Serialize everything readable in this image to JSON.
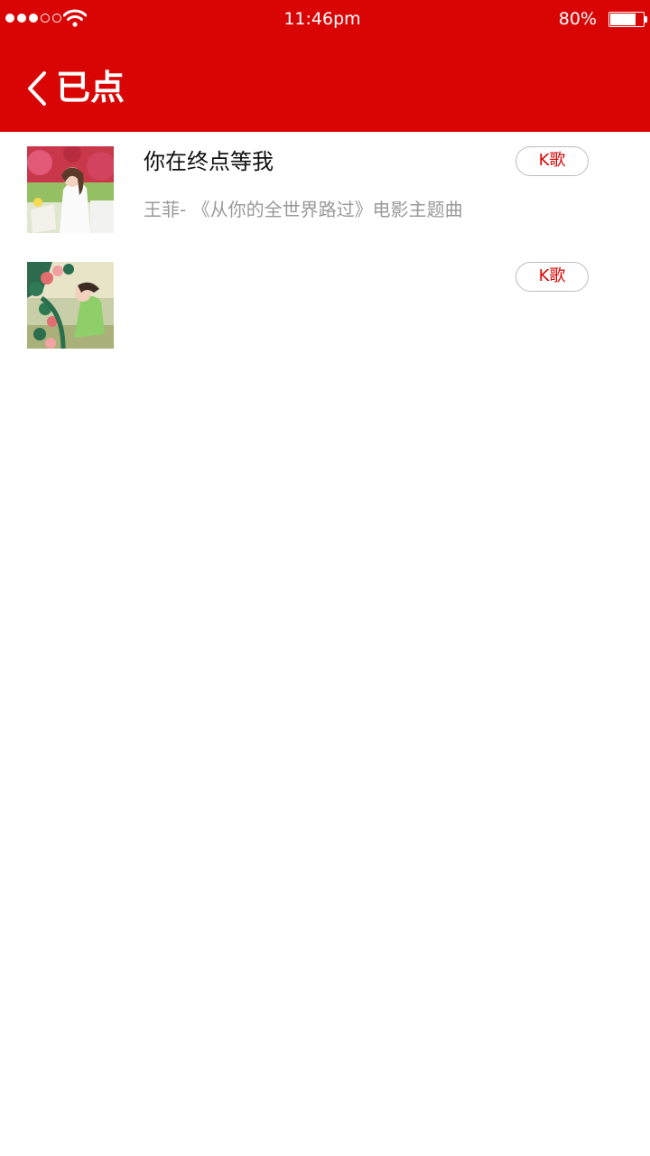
{
  "status_bar": {
    "time": "11:46pm",
    "battery_percent": "80%",
    "battery_level": 0.8,
    "signal_bars_filled": 3,
    "signal_bars_total": 5
  },
  "nav": {
    "back_icon": "chevron-left-icon",
    "title": "已点"
  },
  "colors": {
    "header_bg": "#d90505",
    "title_text": "#111111",
    "subtitle_text": "#999999",
    "button_text": "#d90505",
    "button_border": "#bdbdbd"
  },
  "songs": [
    {
      "title": "你在终点等我",
      "subtitle": "王菲- 《从你的全世界路过》电影主题曲",
      "button_label": "K歌"
    },
    {
      "title": "",
      "subtitle": "",
      "button_label": "K歌"
    }
  ]
}
